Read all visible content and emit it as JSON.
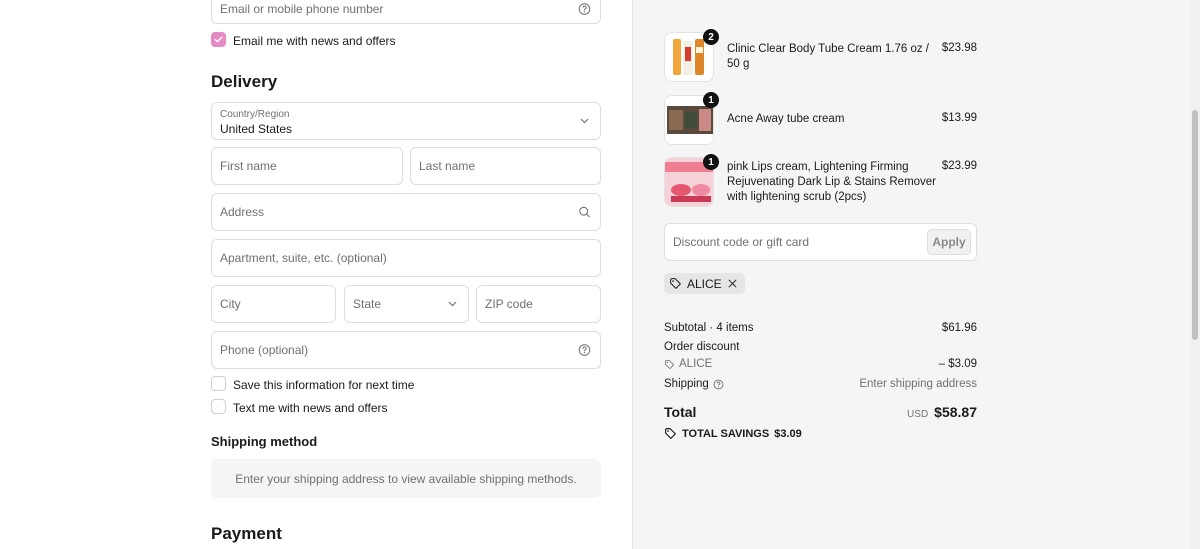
{
  "contact": {
    "email_placeholder": "Email or mobile phone number",
    "news_label": "Email me with news and offers",
    "news_checked": true
  },
  "delivery": {
    "title": "Delivery",
    "country_label": "Country/Region",
    "country_value": "United States",
    "first_name": "First name",
    "last_name": "Last name",
    "address": "Address",
    "apartment": "Apartment, suite, etc. (optional)",
    "city": "City",
    "state": "State",
    "zip": "ZIP code",
    "phone": "Phone (optional)",
    "save_info": "Save this information for next time",
    "text_me": "Text me with news and offers"
  },
  "shipping": {
    "title": "Shipping method",
    "notice": "Enter your shipping address to view available shipping methods."
  },
  "payment": {
    "title": "Payment"
  },
  "cart": {
    "items": [
      {
        "name": "Clinic Clear Body Tube Cream 1.76 oz / 50 g",
        "price": "$23.98",
        "qty": "2"
      },
      {
        "name": "Acne Away tube cream",
        "price": "$13.99",
        "qty": "1"
      },
      {
        "name": "pink Lips cream, Lightening Firming Rejuvenating Dark Lip & Stains Remover with lightening scrub (2pcs)",
        "price": "$23.99",
        "qty": "1"
      }
    ],
    "discount_placeholder": "Discount code or gift card",
    "apply_label": "Apply",
    "applied_code": "ALICE",
    "subtotal_label": "Subtotal · 4 items",
    "subtotal_value": "$61.96",
    "order_discount_label": "Order discount",
    "discount_code": "ALICE",
    "discount_value": "– $3.09",
    "shipping_label": "Shipping",
    "shipping_value": "Enter shipping address",
    "total_label": "Total",
    "currency": "USD",
    "total_value": "$58.87",
    "savings_label": "TOTAL SAVINGS",
    "savings_value": "$3.09"
  },
  "colors": {
    "accent": "#e58ac2",
    "summary_bg": "#f5f5f5"
  }
}
